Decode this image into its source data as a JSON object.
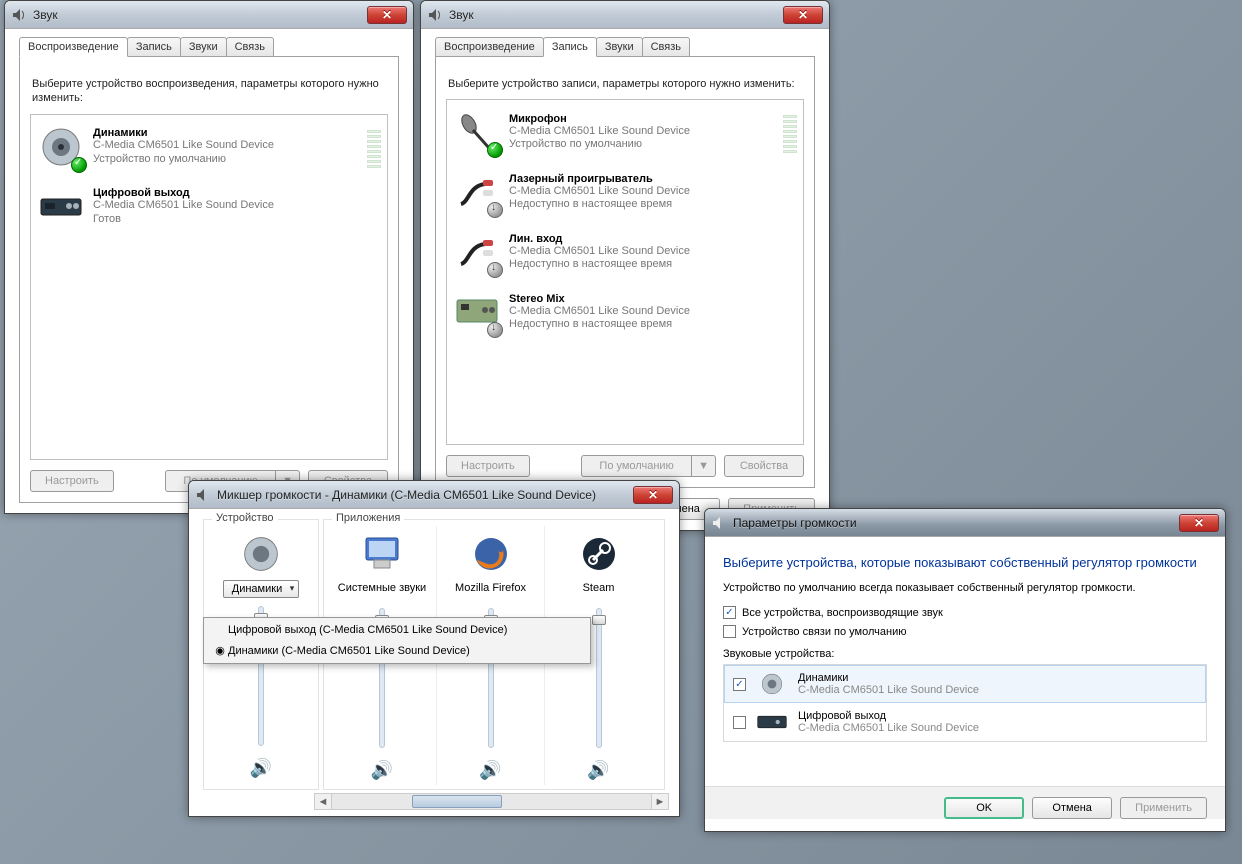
{
  "sound1": {
    "title": "Звук",
    "tabs": [
      "Воспроизведение",
      "Запись",
      "Звуки",
      "Связь"
    ],
    "active_tab": 0,
    "instruction": "Выберите устройство воспроизведения, параметры которого нужно изменить:",
    "devices": [
      {
        "name": "Динамики",
        "sub1": "C-Media CM6501 Like Sound Device",
        "sub2": "Устройство по умолчанию",
        "badge": "ok",
        "meter": true
      },
      {
        "name": "Цифровой выход",
        "sub1": "C-Media CM6501 Like Sound Device",
        "sub2": "Готов",
        "badge": "",
        "meter": false
      }
    ],
    "configure_btn": "Настроить",
    "default_btn": "По умолчанию",
    "props_btn": "Свойства"
  },
  "sound2": {
    "title": "Звук",
    "tabs": [
      "Воспроизведение",
      "Запись",
      "Звуки",
      "Связь"
    ],
    "active_tab": 1,
    "instruction": "Выберите устройство записи, параметры которого нужно изменить:",
    "devices": [
      {
        "name": "Микрофон",
        "sub1": "C-Media CM6501 Like Sound Device",
        "sub2": "Устройство по умолчанию",
        "badge": "ok",
        "meter": true
      },
      {
        "name": "Лазерный проигрыватель",
        "sub1": "C-Media CM6501 Like Sound Device",
        "sub2": "Недоступно в настоящее время",
        "badge": "down",
        "meter": false
      },
      {
        "name": "Лин. вход",
        "sub1": "C-Media CM6501 Like Sound Device",
        "sub2": "Недоступно в настоящее время",
        "badge": "down",
        "meter": false
      },
      {
        "name": "Stereo Mix",
        "sub1": "C-Media CM6501 Like Sound Device",
        "sub2": "Недоступно в настоящее время",
        "badge": "down",
        "meter": false
      }
    ],
    "configure_btn": "Настроить",
    "default_btn": "По умолчанию",
    "props_btn": "Свойства",
    "cancel_btn": "Отмена",
    "apply_btn": "Применить"
  },
  "mixer": {
    "title": "Микшер громкости - Динамики (C-Media CM6501 Like Sound Device)",
    "group_device": "Устройство",
    "group_apps": "Приложения",
    "device_dropdown": "Динамики",
    "apps": [
      {
        "name": "Системные звуки",
        "icon": "monitor"
      },
      {
        "name": "Mozilla Firefox",
        "icon": "firefox"
      },
      {
        "name": "Steam",
        "icon": "steam"
      }
    ],
    "menu": [
      {
        "label": "Цифровой выход (C-Media CM6501 Like Sound Device)",
        "selected": false
      },
      {
        "label": "Динамики (C-Media CM6501 Like Sound Device)",
        "selected": true
      }
    ]
  },
  "volparams": {
    "title": "Параметры громкости",
    "heading": "Выберите устройства, которые показывают собственный регулятор громкости",
    "note": "Устройство по умолчанию всегда показывает собственный регулятор громкости.",
    "chk1": {
      "label": "Все устройства, воспроизводящие звук",
      "checked": true
    },
    "chk2": {
      "label": "Устройство связи по умолчанию",
      "checked": false
    },
    "list_label": "Звуковые устройства:",
    "devices": [
      {
        "name": "Динамики",
        "sub": "C-Media CM6501 Like Sound Device",
        "checked": true,
        "selected": true
      },
      {
        "name": "Цифровой выход",
        "sub": "C-Media CM6501 Like Sound Device",
        "checked": false,
        "selected": false
      }
    ],
    "ok": "OK",
    "cancel": "Отмена",
    "apply": "Применить"
  }
}
